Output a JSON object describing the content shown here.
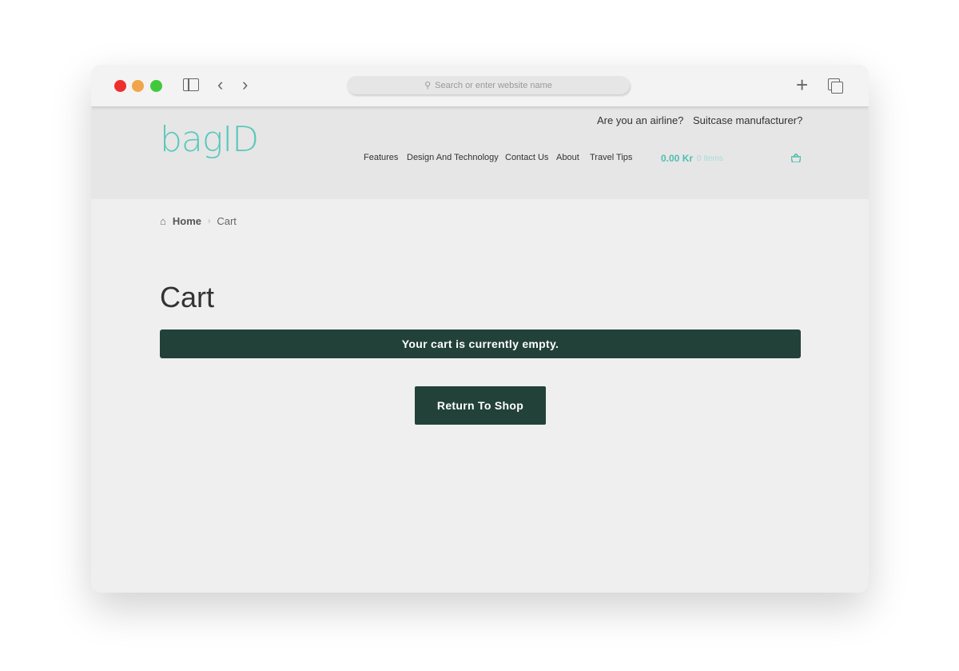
{
  "browser": {
    "url_placeholder": "Search or enter website name"
  },
  "site": {
    "logo": "bagID",
    "top_links": [
      "Are you an airline?",
      "Suitcase manufacturer?"
    ],
    "nav": [
      "Features",
      "Design And Technology",
      "Contact Us",
      "About",
      "Travel Tips"
    ],
    "cart_total": "0.00 Kr",
    "cart_items": "0 Items",
    "accent": "#5cc8ba"
  },
  "breadcrumb": {
    "home": "Home",
    "current": "Cart"
  },
  "page": {
    "title": "Cart",
    "notice": "Your cart is currently empty.",
    "return_button": "Return To Shop"
  }
}
